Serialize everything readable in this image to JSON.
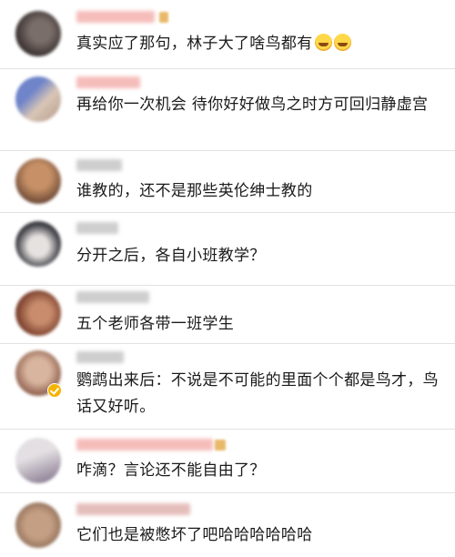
{
  "comments": [
    {
      "text": "真实应了那句，林子大了啥鸟都有",
      "emoji": [
        "laughing-crying-emoji",
        "laughing-crying-emoji"
      ],
      "name_color": "#f4b6b3",
      "avatar_colors": [
        "#3a3230",
        "#7a6e6a"
      ]
    },
    {
      "text": "再给你一次机会 待你好好做鸟之时方可回归静虚宫",
      "name_color": "#f4b6b3",
      "avatar_colors": [
        "#6f84c9",
        "#d9c6b6"
      ]
    },
    {
      "text": "谁教的，还不是那些英伦绅士教的",
      "name_color": "#c9c9c9",
      "avatar_colors": [
        "#c79066",
        "#6d4a36"
      ]
    },
    {
      "text": "分开之后，各自小班教学？",
      "name_color": "#c9c9c9",
      "avatar_colors": [
        "#3d3d44",
        "#e6e2e0"
      ]
    },
    {
      "text": "五个老师各带一班学生",
      "name_color": "#c9c9c9",
      "avatar_colors": [
        "#7a3f2c",
        "#c98d6d"
      ]
    },
    {
      "text": "鹦鹉出来后：不说是不可能的里面个个都是鸟才，鸟话又好听。",
      "name_color": "#c9c9c9",
      "avatar_colors": [
        "#d8b59e",
        "#8a5a48"
      ],
      "verified": true
    },
    {
      "text": "咋滴？言论还不能自由了？",
      "name_color": "#f4b6b3",
      "avatar_colors": [
        "#e3dfe2",
        "#7d6e86"
      ]
    },
    {
      "text": "它们也是被憋坏了吧哈哈哈哈哈哈",
      "name_color": "#e2b7b4",
      "avatar_colors": [
        "#c59f83",
        "#8a6a55"
      ]
    }
  ]
}
